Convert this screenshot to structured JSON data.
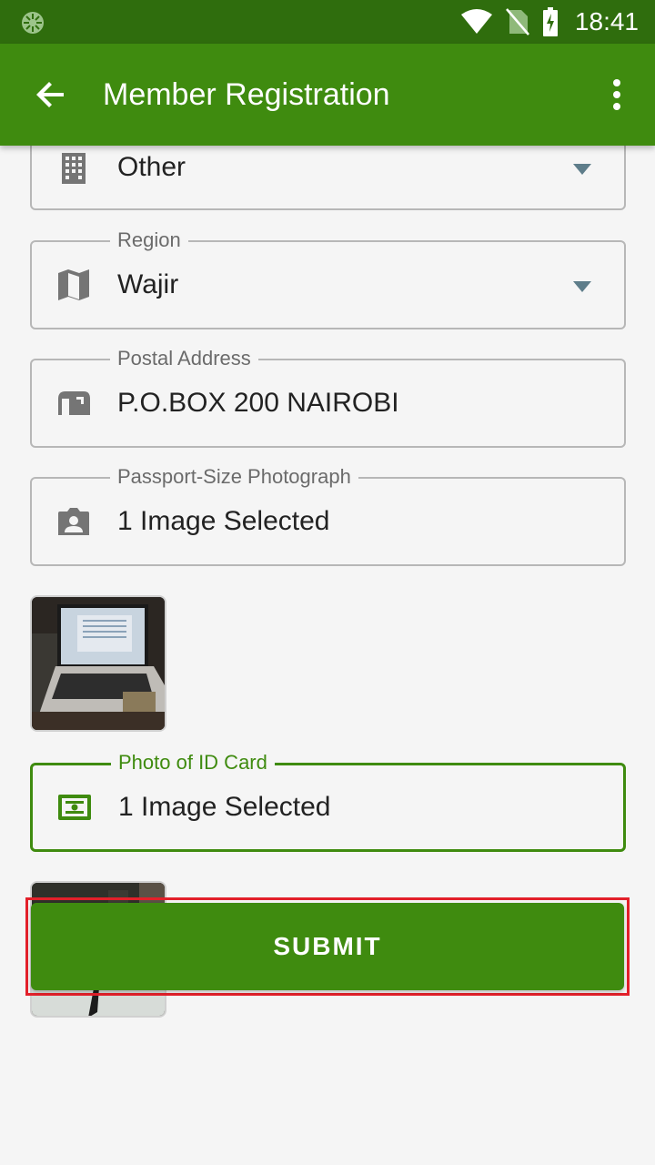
{
  "status_bar": {
    "time": "18:41",
    "icons": [
      "app-notification-icon",
      "wifi-icon",
      "no-sim-icon",
      "battery-charging-icon"
    ]
  },
  "app_bar": {
    "title": "Member Registration",
    "back_icon": "arrow-back-icon",
    "menu_icon": "more-vert-icon"
  },
  "form": {
    "organization_type": {
      "value": "Other",
      "icon": "building-icon"
    },
    "region": {
      "label": "Region",
      "value": "Wajir",
      "icon": "map-icon"
    },
    "postal_address": {
      "label": "Postal Address",
      "value": "P.O.BOX 200 NAIROBI",
      "icon": "mailbox-icon"
    },
    "passport_photo": {
      "label": "Passport-Size Photograph",
      "value": "1 Image Selected",
      "icon": "contact-camera-icon"
    },
    "id_photo": {
      "label": "Photo of ID Card",
      "value": "1 Image Selected",
      "icon": "id-card-icon"
    }
  },
  "submit": {
    "label": "SUBMIT"
  },
  "colors": {
    "primary": "#3f8b0f",
    "status_bar": "#2f6d0d",
    "highlight": "#e3202a"
  }
}
